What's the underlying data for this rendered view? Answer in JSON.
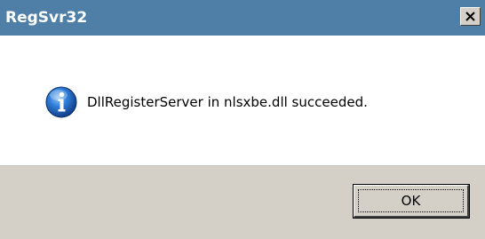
{
  "window": {
    "title": "RegSvr32",
    "title_bar_color": "#4f7fa7",
    "close_icon": "close-icon"
  },
  "dialog": {
    "icon": "info-icon",
    "message": "DllRegisterServer in nlsxbe.dll succeeded."
  },
  "buttons": {
    "ok_label": "OK"
  }
}
